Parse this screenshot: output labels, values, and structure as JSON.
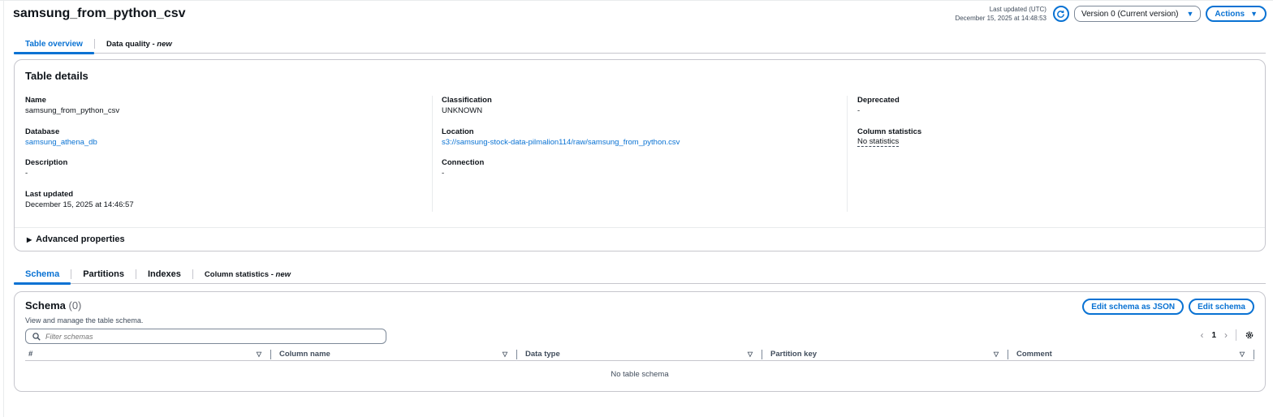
{
  "header": {
    "title": "samsung_from_python_csv",
    "last_updated_label": "Last updated (UTC)",
    "last_updated_value": "December 15, 2025 at 14:48:53",
    "version_select": "Version 0 (Current version)",
    "actions_label": "Actions"
  },
  "top_tabs": {
    "overview": "Table overview",
    "quality": "Data quality - ",
    "quality_new": "new"
  },
  "details": {
    "title": "Table details",
    "name_label": "Name",
    "name_value": "samsung_from_python_csv",
    "database_label": "Database",
    "database_value": "samsung_athena_db",
    "description_label": "Description",
    "description_value": "-",
    "last_updated_label": "Last updated",
    "last_updated_value": "December 15, 2025 at 14:46:57",
    "classification_label": "Classification",
    "classification_value": "UNKNOWN",
    "location_label": "Location",
    "location_value": "s3://samsung-stock-data-pilmalion114/raw/samsung_from_python.csv",
    "connection_label": "Connection",
    "connection_value": "-",
    "deprecated_label": "Deprecated",
    "deprecated_value": "-",
    "column_stats_label": "Column statistics",
    "column_stats_value": "No statistics",
    "advanced_properties": "Advanced properties"
  },
  "bottom_tabs": {
    "schema": "Schema",
    "partitions": "Partitions",
    "indexes": "Indexes",
    "column_statistics": "Column statistics - ",
    "column_statistics_new": "new"
  },
  "schema": {
    "title": "Schema",
    "count": "(0)",
    "description": "View and manage the table schema.",
    "edit_json": "Edit schema as JSON",
    "edit": "Edit schema",
    "filter_placeholder": "Filter schemas",
    "page": "1",
    "columns": [
      "#",
      "Column name",
      "Data type",
      "Partition key",
      "Comment"
    ],
    "empty_text": "No table schema"
  },
  "colors": {
    "accent": "#0972d3",
    "text": "#0f141a",
    "border": "#c6c6cd"
  }
}
